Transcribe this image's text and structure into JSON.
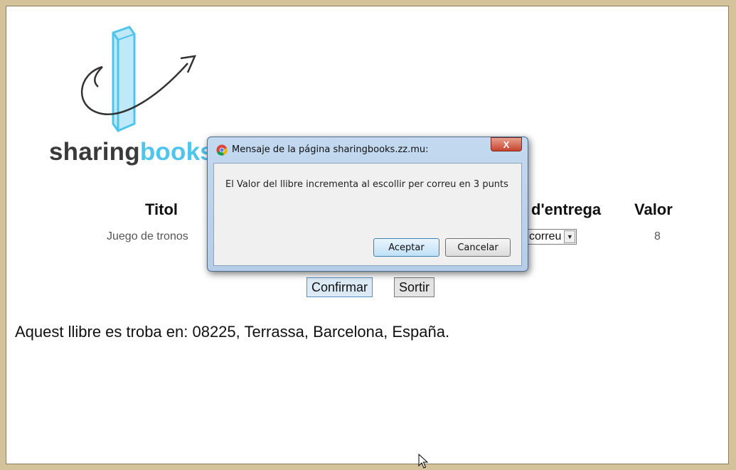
{
  "logo": {
    "text_part1": "sharing",
    "text_part2": "books"
  },
  "table": {
    "headers": {
      "title": "Titol",
      "delivery": "d'entrega",
      "value": "Valor"
    },
    "row": {
      "title": "Juego de tronos",
      "delivery_selected": "correu",
      "value": "8"
    }
  },
  "buttons": {
    "confirm": "Confirmar",
    "exit": "Sortir"
  },
  "location_text": "Aquest llibre es troba en: 08225, Terrassa, Barcelona, España.",
  "dialog": {
    "title": "Mensaje de la página sharingbooks.zz.mu:",
    "close_label": "X",
    "message": "El Valor del llibre incrementa al escollir per correu en 3 punts",
    "ok_label": "Aceptar",
    "cancel_label": "Cancelar"
  },
  "colors": {
    "brand_blue": "#4fc4ec",
    "brand_gray": "#3a3a3a",
    "frame": "#d4c29b"
  }
}
